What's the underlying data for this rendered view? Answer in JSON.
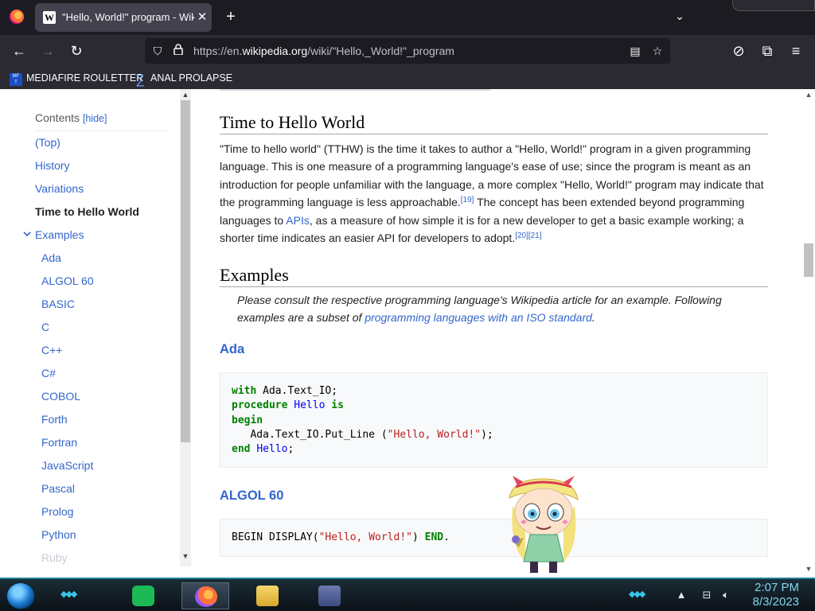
{
  "browser": {
    "tab_title": "\"Hello, World!\" program - Wikip",
    "tab_favicon": "W",
    "tab_close": "✕",
    "new_tab": "+",
    "url_prefix": "https://en.",
    "url_domain": "wikipedia.org",
    "url_path": "/wiki/\"Hello,_World!\"_program",
    "bookmarks": [
      {
        "label": "MEDIAFIRE ROULETTER",
        "icon": "mediafire-icon"
      },
      {
        "label": "ANAL PROLAPSE",
        "icon": "sigma-icon"
      }
    ]
  },
  "toc": {
    "header": "Contents",
    "hide_label": "[hide]",
    "items": [
      {
        "label": "(Top)"
      },
      {
        "label": "History"
      },
      {
        "label": "Variations"
      },
      {
        "label": "Time to Hello World"
      },
      {
        "label": "Examples"
      },
      {
        "label": "Ada"
      },
      {
        "label": "ALGOL 60"
      },
      {
        "label": "BASIC"
      },
      {
        "label": "C"
      },
      {
        "label": "C++"
      },
      {
        "label": "C#"
      },
      {
        "label": "COBOL"
      },
      {
        "label": "Forth"
      },
      {
        "label": "Fortran"
      },
      {
        "label": "JavaScript"
      },
      {
        "label": "Pascal"
      },
      {
        "label": "Prolog"
      },
      {
        "label": "Python"
      },
      {
        "label": "Ruby"
      }
    ]
  },
  "article": {
    "section_tthw": {
      "heading": "Time to Hello World",
      "text_1": "\"Time to hello world\" (TTHW) is the time it takes to author a \"Hello, World!\" program in a given programming language. This is one measure of a programming language's ease of use; since the program is meant as an introduction for people unfamiliar with the language, a more complex \"Hello, World!\" program may indicate that the programming language is less approachable.",
      "ref_19": "[19]",
      "text_2": " The concept has been extended beyond programming languages to ",
      "link_apis": "APIs",
      "text_3": ", as a measure of how simple it is for a new developer to get a basic example working; a shorter time indicates an easier API for developers to adopt.",
      "ref_20": "[20]",
      "ref_21": "[21]"
    },
    "section_examples": {
      "heading": "Examples",
      "hatnote_1": "Please consult the respective programming language's Wikipedia article for an example. Following examples are a subset of ",
      "hatnote_link": "programming languages with an ISO standard",
      "hatnote_2": "."
    },
    "ada": {
      "heading": "Ada",
      "l1_kw": "with",
      "l1_rest": " Ada.Text_IO;",
      "l2_kw1": "procedure",
      "l2_name": "Hello",
      "l2_kw2": "is",
      "l3_kw": "begin",
      "l4_a": "   Ada.Text_IO.Put_Line (",
      "l4_str": "\"Hello, World!\"",
      "l4_b": ");",
      "l5_kw": "end",
      "l5_name": "Hello",
      "l5_end": ";"
    },
    "algol": {
      "heading": "ALGOL 60",
      "a": "BEGIN DISPLAY(",
      "str": "\"Hello, World!\"",
      "b": ") ",
      "kw": "END",
      "c": "."
    }
  },
  "taskbar": {
    "time": "2:07 PM",
    "date": "8/3/2023",
    "apps": [
      "spotify-icon",
      "firefox-icon",
      "file-explorer-icon",
      "tool-icon"
    ]
  }
}
